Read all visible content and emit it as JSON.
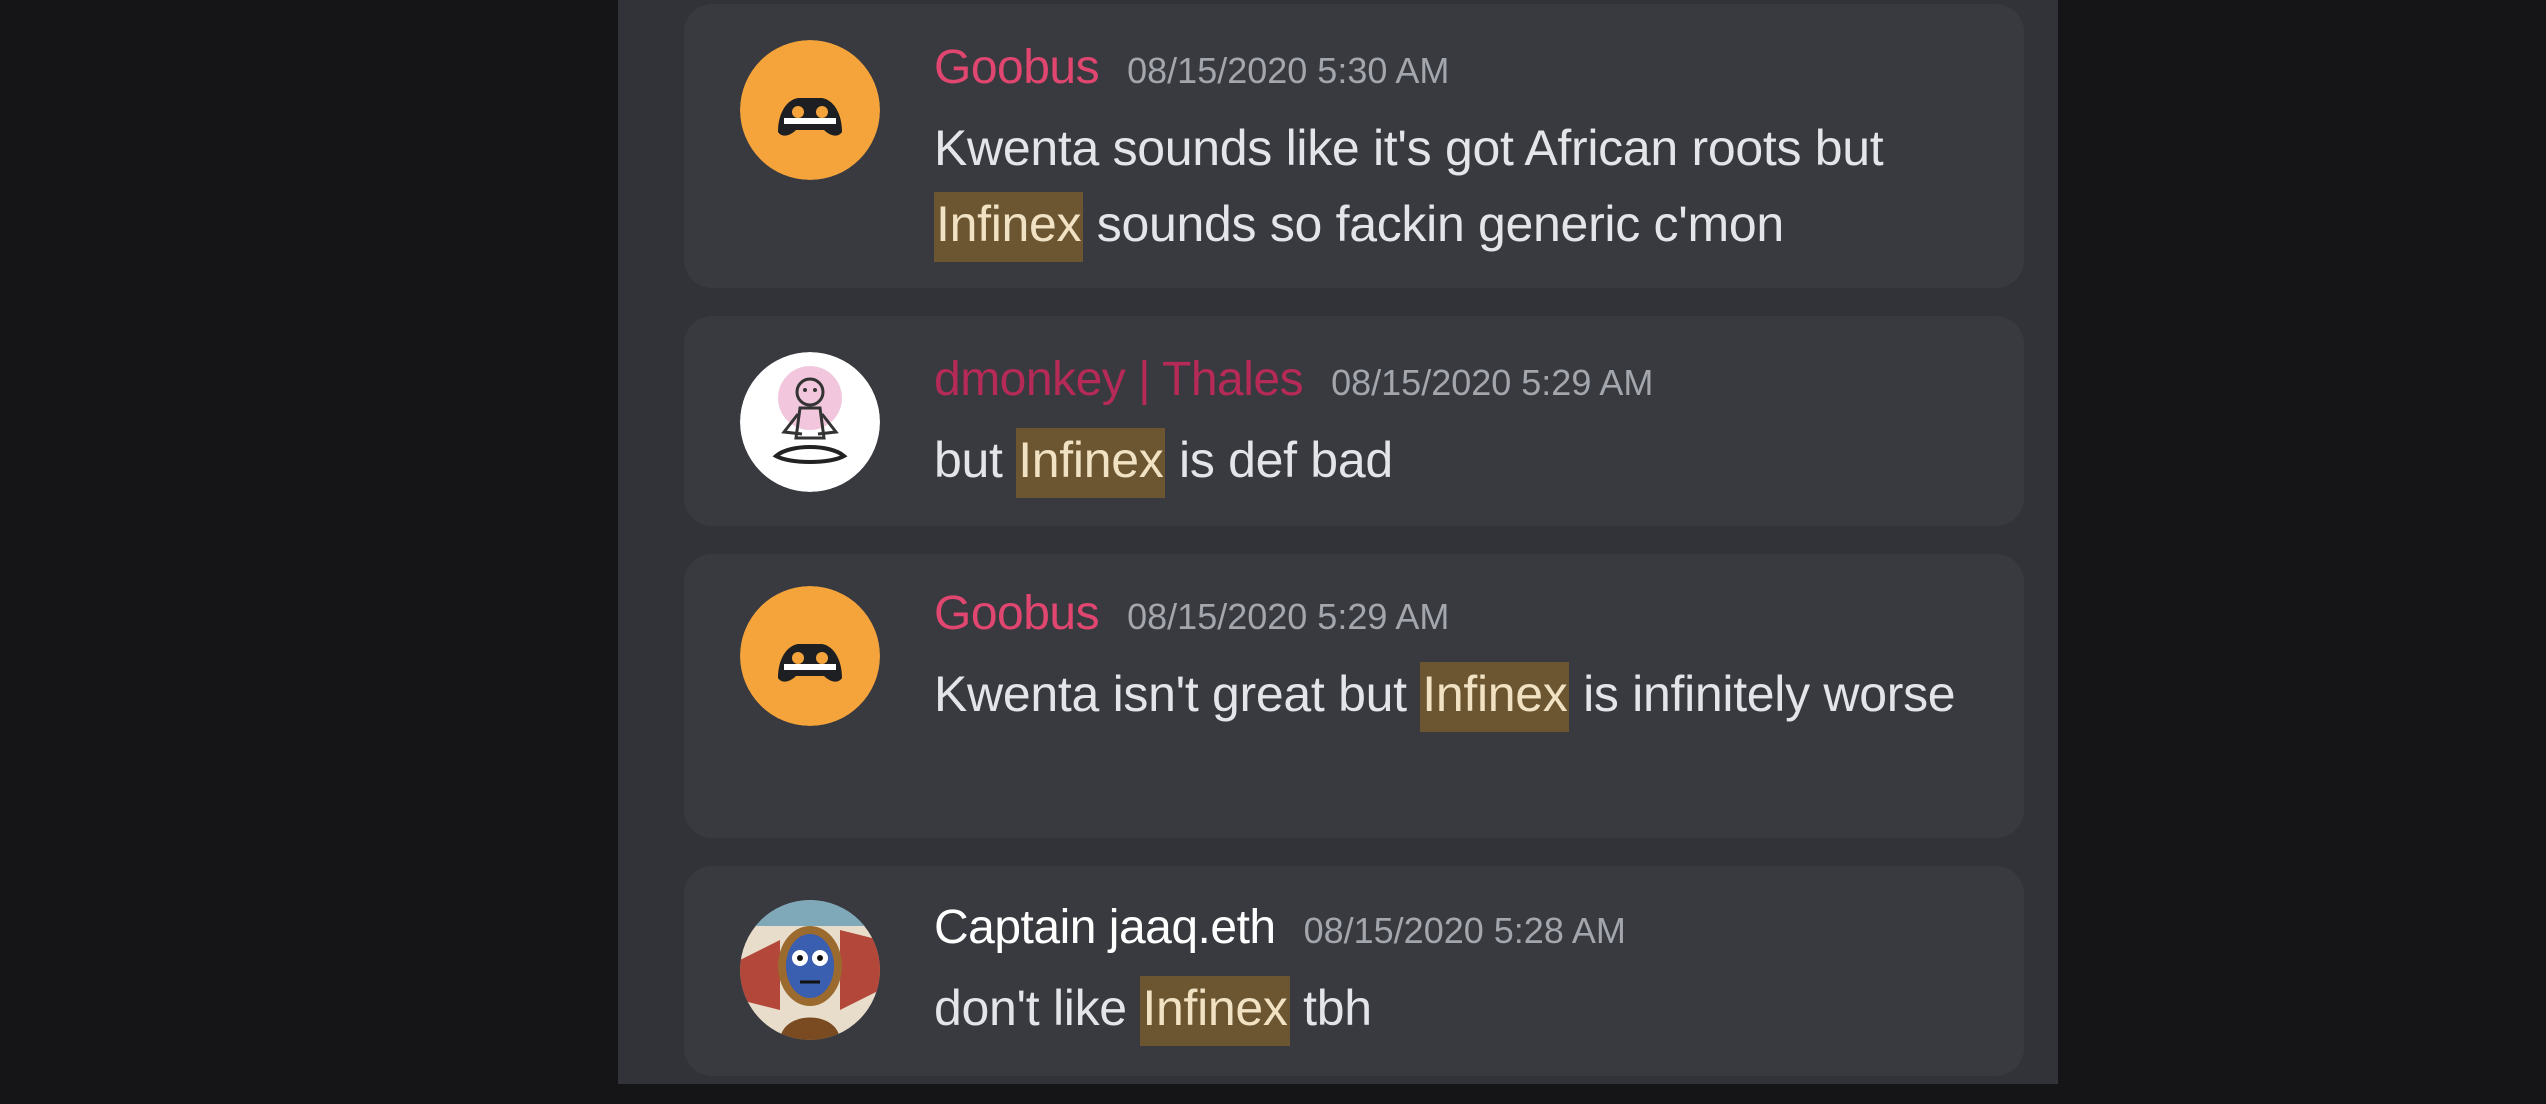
{
  "colors": {
    "background": "#151517",
    "panel": "#313338",
    "card": "#383a40",
    "goobus_name": "#e0466f",
    "dmonkey_name": "#b52a56",
    "captain_name": "#ffffff",
    "timestamp": "#a3a6ad",
    "highlight": "#6b5631"
  },
  "messages": [
    {
      "author": "Goobus",
      "avatar_icon": "discord-logo-orange-avatar",
      "timestamp": "08/15/2020 5:30 AM",
      "text_before": "Kwenta sounds like it's got African roots but ",
      "highlight": "Infinex",
      "text_after": " sounds so fackin generic c'mon"
    },
    {
      "author": "dmonkey | Thales",
      "avatar_icon": "meditating-monkey-avatar",
      "timestamp": "08/15/2020 5:29 AM",
      "text_before": "but ",
      "highlight": "Infinex",
      "text_after": " is def bad"
    },
    {
      "author": "Goobus",
      "avatar_icon": "discord-logo-orange-avatar",
      "timestamp": "08/15/2020 5:29 AM",
      "text_before": "Kwenta isn't great but ",
      "highlight": "Infinex",
      "text_after": " is infinitely worse"
    },
    {
      "author": "Captain jaaq.eth",
      "avatar_icon": "blue-face-character-avatar",
      "timestamp": "08/15/2020 5:28 AM",
      "text_before": "don't like ",
      "highlight": "Infinex",
      "text_after": " tbh"
    }
  ]
}
